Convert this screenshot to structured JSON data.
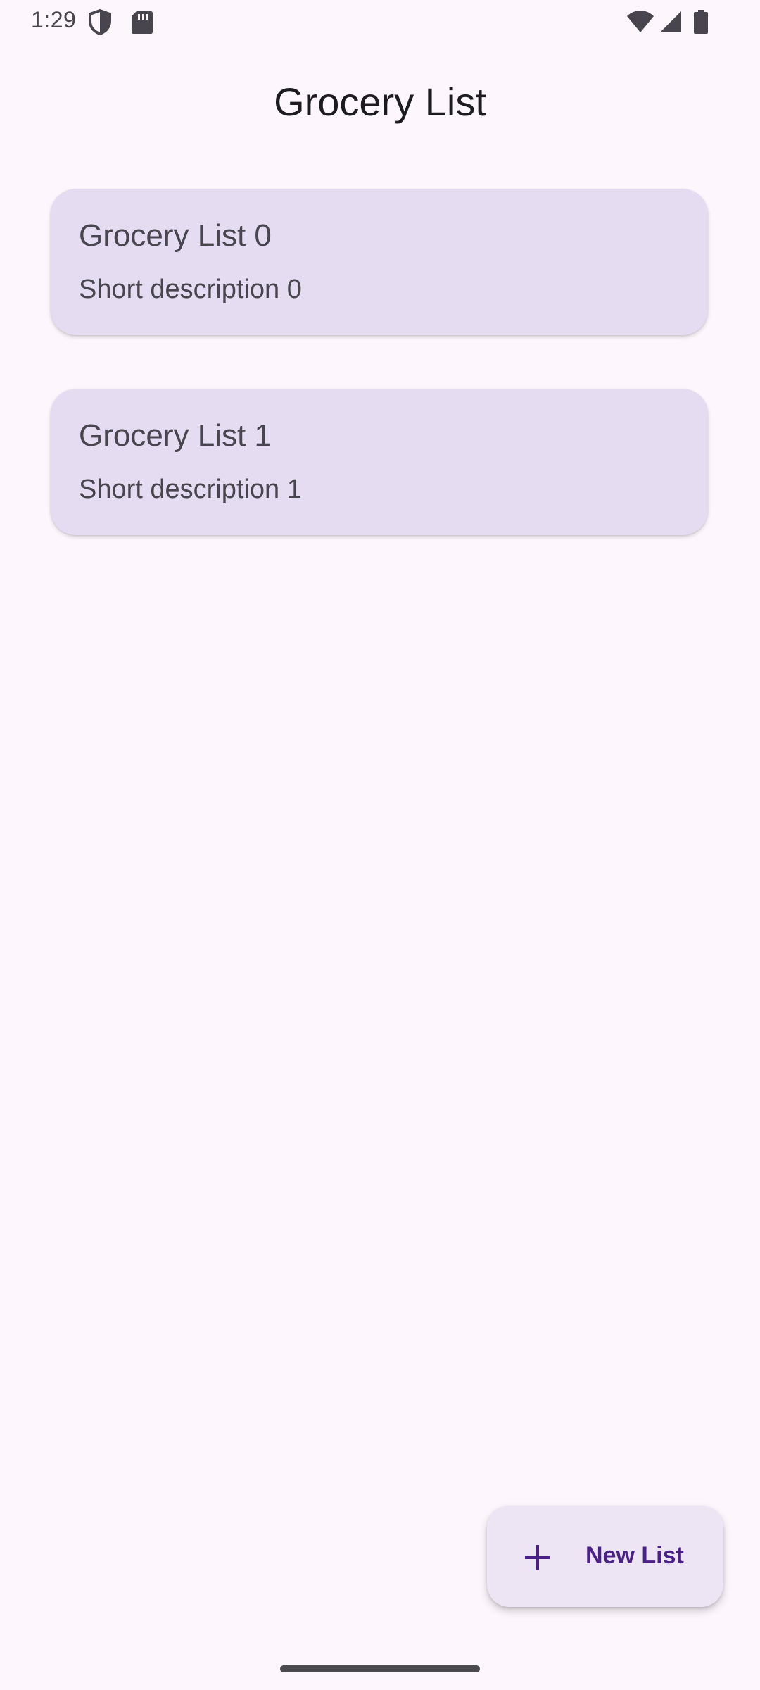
{
  "status_bar": {
    "time": "1:29",
    "left_icons": [
      "shield-icon",
      "sd-card-icon"
    ],
    "right_icons": [
      "wifi-icon",
      "cellular-signal-icon",
      "battery-icon"
    ]
  },
  "header": {
    "title": "Grocery List"
  },
  "lists": [
    {
      "title": "Grocery List 0",
      "description": "Short description 0"
    },
    {
      "title": "Grocery List 1",
      "description": "Short description 1"
    }
  ],
  "fab": {
    "icon": "plus-icon",
    "label": "New List"
  },
  "colors": {
    "background": "#FDF7FD",
    "card": "#E5DCF1",
    "fab": "#EDE5F4",
    "accent": "#4A2187",
    "text": "#1D1B20",
    "secondary_text": "#49454F"
  }
}
